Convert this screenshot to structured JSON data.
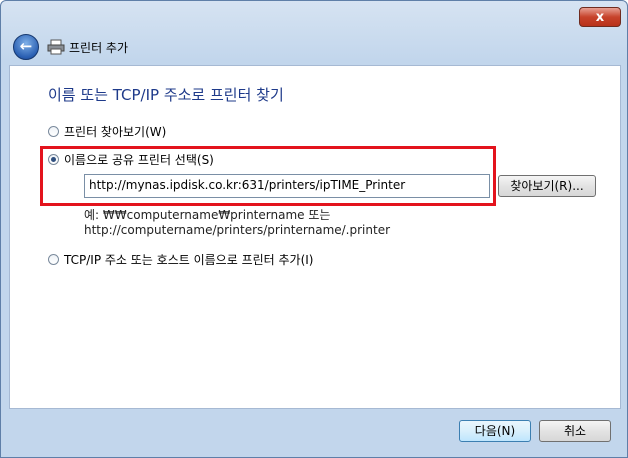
{
  "window": {
    "close_label": "x"
  },
  "header": {
    "title": "프린터 추가",
    "back_icon": "back-arrow-icon",
    "app_icon": "printer-icon"
  },
  "main": {
    "heading": "이름 또는 TCP/IP 주소로 프린터 찾기",
    "options": [
      {
        "label": "프린터 찾아보기(W)",
        "checked": false
      },
      {
        "label": "이름으로 공유 프린터 선택(S)",
        "checked": true
      },
      {
        "label": "TCP/IP 주소 또는 호스트 이름으로 프린터 추가(I)",
        "checked": false
      }
    ],
    "share_input": {
      "value": "http://mynas.ipdisk.co.kr:631/printers/ipTIME_Printer"
    },
    "browse_button": "찾아보기(R)...",
    "example_line1": "예: ₩₩computername₩printername 또는",
    "example_line2": "http://computername/printers/printername/.printer"
  },
  "footer": {
    "next_button": "다음(N)",
    "cancel_button": "취소"
  },
  "colors": {
    "heading": "#1e3a8a",
    "highlight": "#e3131d"
  }
}
